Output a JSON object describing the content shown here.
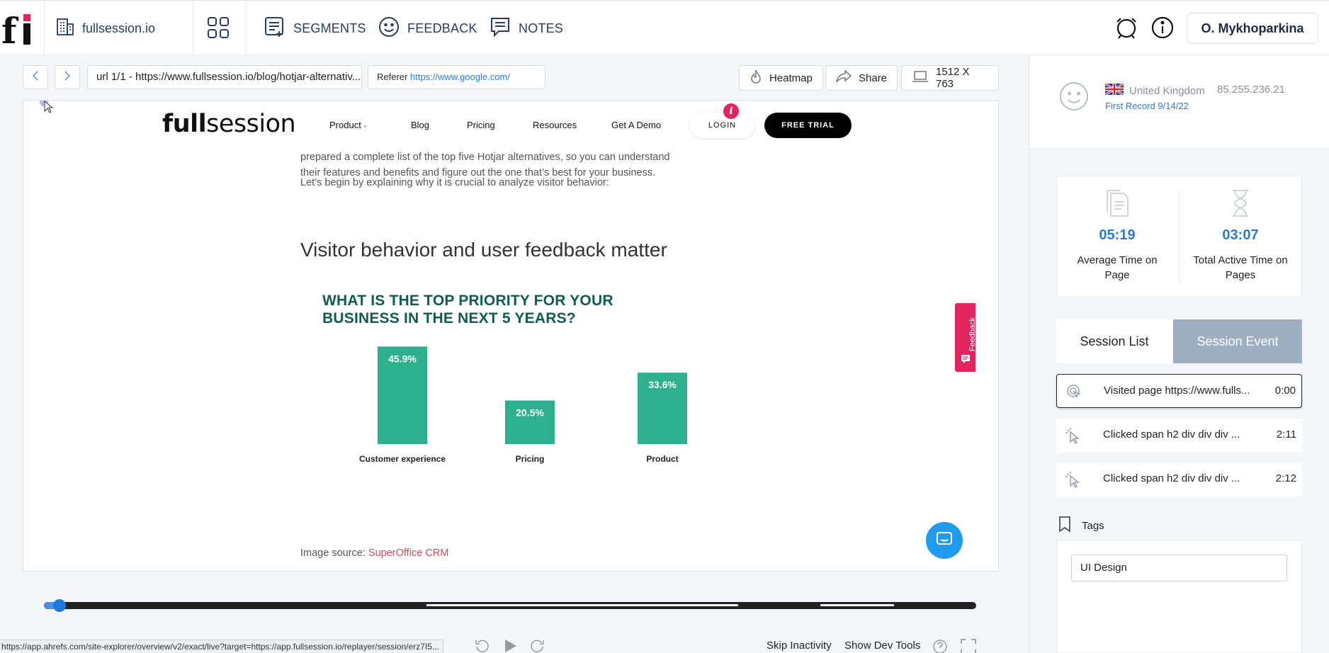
{
  "topbar": {
    "logo_text": "fi",
    "site_name": "fullsession.io",
    "nav": [
      {
        "label": "SEGMENTS",
        "icon": "segments-icon"
      },
      {
        "label": "FEEDBACK",
        "icon": "smiley-icon"
      },
      {
        "label": "NOTES",
        "icon": "notes-icon"
      }
    ],
    "user_name": "O. Mykhoparkina"
  },
  "replay_toolbar": {
    "url_text": "url 1/1 -  https://www.fullsession.io/blog/hotjar-alternativ...",
    "referer_label": "Referer",
    "referer_url": "https://www.google.com/",
    "heatmap_label": "Heatmap",
    "share_label": "Share",
    "resolution": "1512 X 763"
  },
  "viewport": {
    "logo_bold": "full",
    "logo_rest": "session",
    "nav": [
      "Product",
      "Blog",
      "Pricing",
      "Resources",
      "Get A Demo"
    ],
    "login_label": "LOGIN",
    "info_badge": "i",
    "trial_label": "FREE TRIAL",
    "para1_line1": "prepared a complete list of the top five Hotjar alternatives, so you can understand",
    "para1_line2": "their features and benefits and figure out the one that’s best for your business.",
    "para2": "Let’s begin by explaining why it is crucial to analyze visitor behavior:",
    "heading": "Visitor behavior and user feedback matter",
    "chart_title_line1": "WHAT IS THE TOP PRIORITY FOR YOUR",
    "chart_title_line2": "BUSINESS IN THE NEXT 5 YEARS?",
    "image_source_label": "Image source:",
    "image_source_link": "SuperOffice CRM",
    "feedback_tab": "Feedback"
  },
  "chart_data": {
    "type": "bar",
    "title": "WHAT IS THE TOP PRIORITY FOR YOUR BUSINESS IN THE NEXT 5 YEARS?",
    "categories": [
      "Customer experience",
      "Pricing",
      "Product"
    ],
    "values": [
      45.9,
      20.5,
      33.6
    ],
    "value_labels": [
      "45.9%",
      "20.5%",
      "33.6%"
    ],
    "ylim": [
      0,
      50
    ],
    "grid": false,
    "bar_color": "#2db08d"
  },
  "playback": {
    "progress": 0.01,
    "status_url": "https://app.ahrefs.com/site-explorer/overview/v2/exact/live?target=https://app.fullsession.io/replayer/session/erz7I5...",
    "skip_inactivity_label": "Skip Inactivity",
    "dev_tools_label": "Show Dev Tools"
  },
  "panel": {
    "country": "United Kingdom",
    "ip": "85.255.236.21",
    "first_record": "First Record 9/14/22",
    "stats": [
      {
        "value": "05:19",
        "label_line1": "Average Time on",
        "label_line2": "Page"
      },
      {
        "value": "03:07",
        "label_line1": "Total Active Time on",
        "label_line2": "Pages"
      }
    ],
    "tabs": [
      "Session List",
      "Session Event"
    ],
    "events": [
      {
        "text": "Visited page https://www.fulls...",
        "time": "0:00"
      },
      {
        "text": "Clicked span h2 div div div ...",
        "time": "2:11"
      },
      {
        "text": "Clicked span h2 div div div ...",
        "time": "2:12"
      }
    ],
    "tags_label": "Tags",
    "tag_value": "UI Design"
  },
  "colors": {
    "accent_blue": "#2a7bd6",
    "brand_red": "#e0245e",
    "chart_green": "#2db08d",
    "session_event_tab": "#9dafc0"
  }
}
